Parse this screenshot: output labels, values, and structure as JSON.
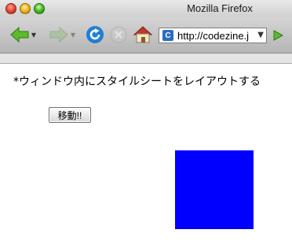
{
  "window": {
    "title": "Mozilla Firefox"
  },
  "toolbar": {
    "url": "http://codezine.j",
    "site_icon_letter": "C"
  },
  "page": {
    "heading": "*ウィンドウ内にスタイルシートをレイアウトする",
    "move_button_label": "移動!!"
  },
  "colors": {
    "box": "#0000ff",
    "back_arrow": "#5dbb2e",
    "reload": "#1f7fd6"
  }
}
